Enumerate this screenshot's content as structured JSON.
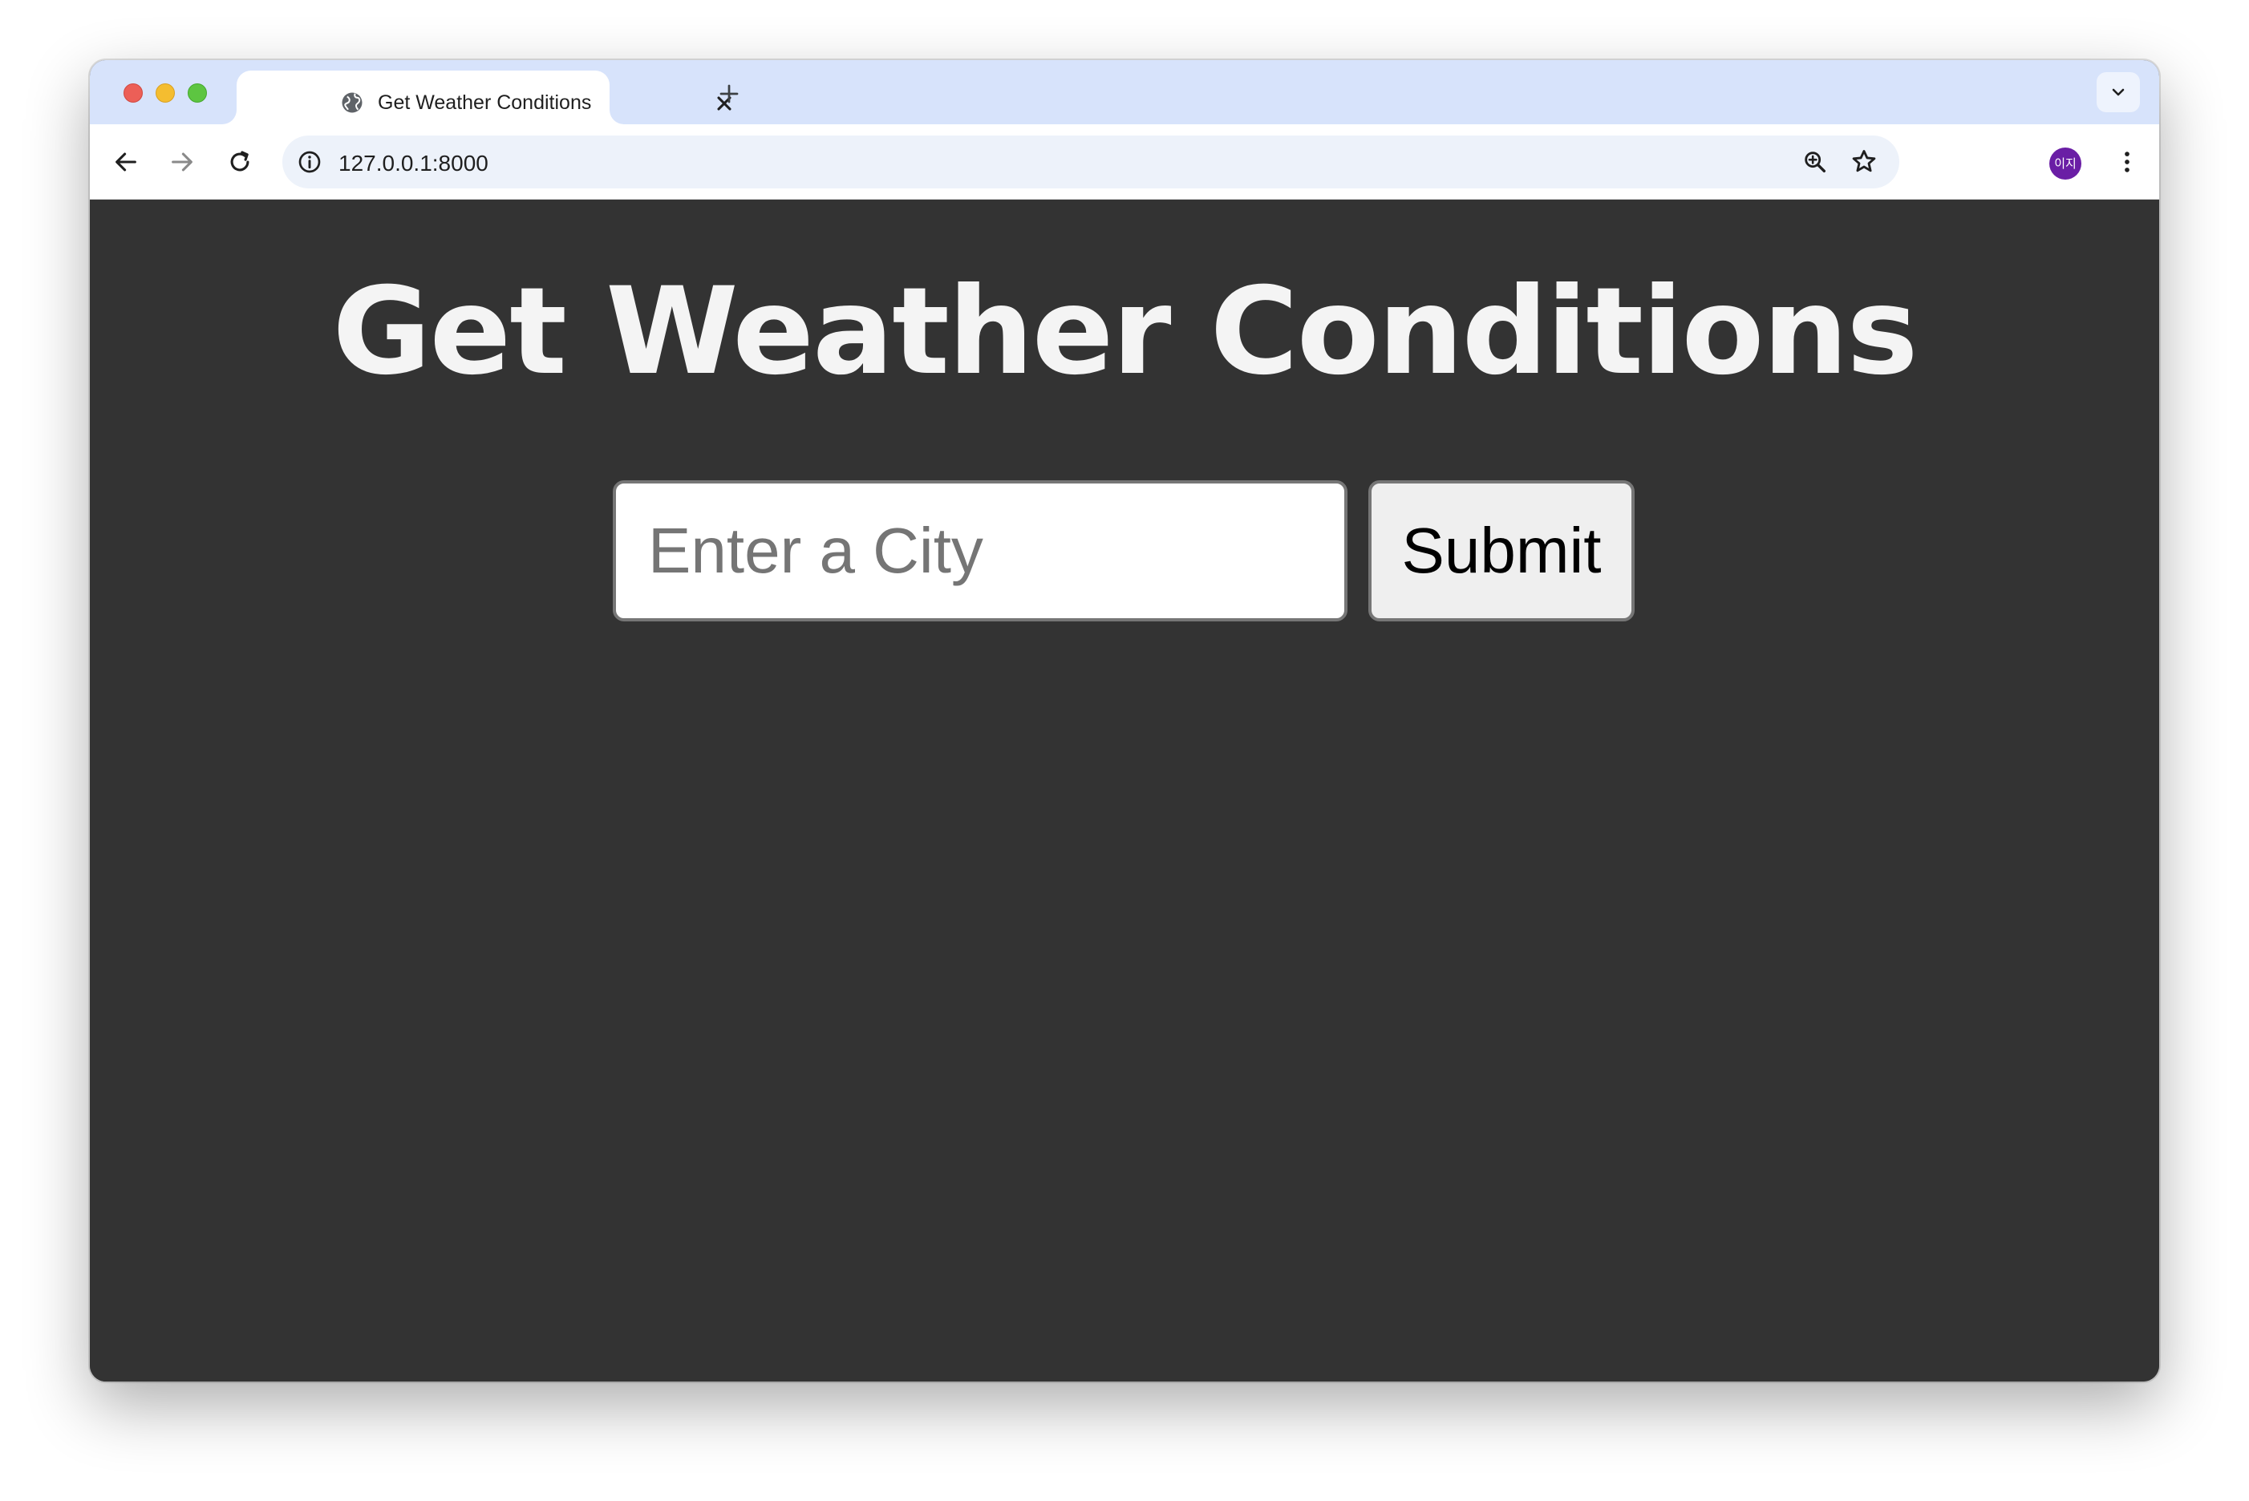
{
  "browser": {
    "tab": {
      "title": "Get Weather Conditions",
      "favicon": "globe-icon"
    },
    "address_bar": {
      "url": "127.0.0.1:8000",
      "site_info_icon": "info-icon"
    },
    "profile": {
      "initials": "이지",
      "color": "#6a1ea5"
    }
  },
  "page": {
    "title": "Get Weather Conditions",
    "city_input": {
      "placeholder": "Enter a City",
      "value": ""
    },
    "submit_label": "Submit",
    "background_color": "#333333"
  }
}
